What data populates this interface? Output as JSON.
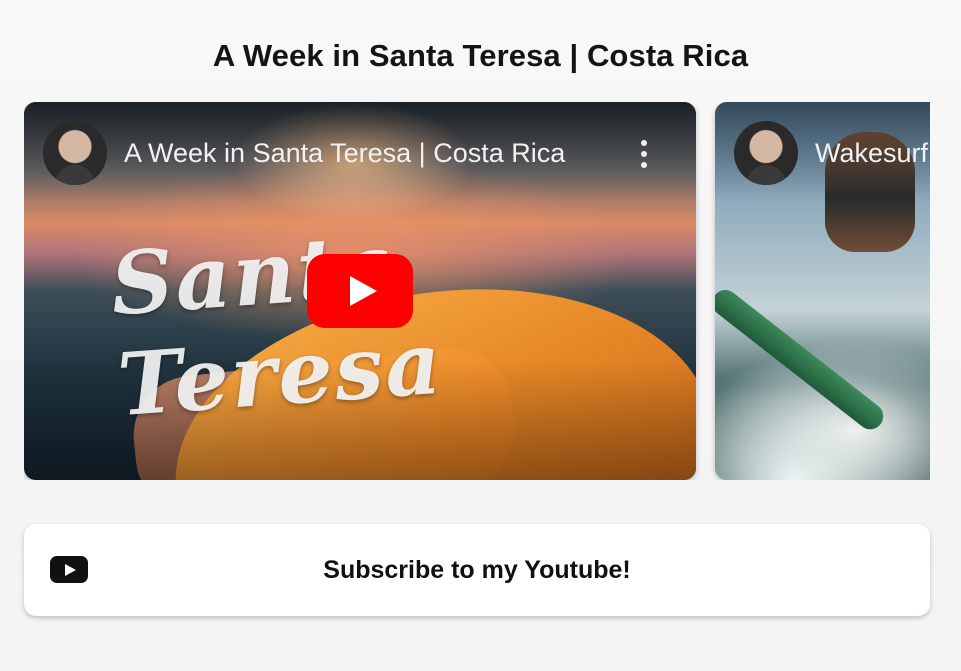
{
  "page": {
    "title": "A Week in Santa Teresa | Costa Rica"
  },
  "videos": [
    {
      "title": "A Week in Santa Teresa | Costa Rica",
      "thumbnail_text": "Santa Teresa",
      "avatar_icon": "channel-avatar",
      "more_icon": "more-vertical-icon",
      "play_icon": "youtube-play-icon"
    },
    {
      "title": "Wakesurf",
      "avatar_icon": "channel-avatar"
    }
  ],
  "subscribe": {
    "label": "Subscribe to my Youtube!",
    "icon": "youtube-icon"
  },
  "colors": {
    "play_button": "#ff0000",
    "text_dark": "#111111",
    "card_bg": "#ffffff",
    "page_bg": "#f6f6f6"
  }
}
